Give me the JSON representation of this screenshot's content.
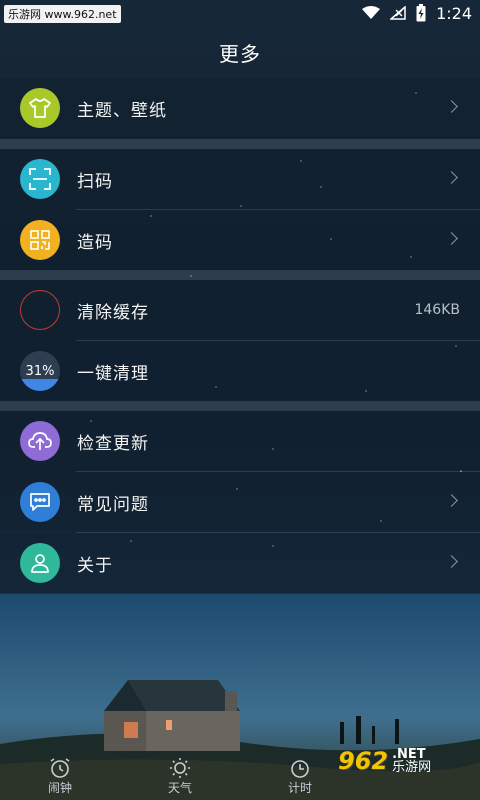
{
  "status_bar": {
    "watermark": "乐游网 www.962.net",
    "time": "1:24",
    "icons": [
      "wifi-icon",
      "signal-off-icon",
      "battery-charging-icon"
    ]
  },
  "header": {
    "title": "更多"
  },
  "menu": {
    "theme": {
      "label": "主题、壁纸",
      "icon": "tshirt-icon",
      "icon_color": "#a9c92b"
    },
    "scan": {
      "label": "扫码",
      "icon": "scan-icon",
      "icon_color": "#2bb6d0"
    },
    "make_code": {
      "label": "造码",
      "icon": "qr-code-icon",
      "icon_color": "#f2b21f"
    },
    "clear_cache": {
      "label": "清除缓存",
      "value": "146KB",
      "icon": "ring-icon",
      "icon_color": "#c23a3a"
    },
    "clean": {
      "label": "一键清理",
      "value": "31%",
      "fill_fraction": 0.31,
      "icon_color": "#3f86e6"
    },
    "update": {
      "label": "检查更新",
      "icon": "cloud-upload-icon",
      "icon_color": "#8f6bd6"
    },
    "faq": {
      "label": "常见问题",
      "icon": "chat-bubble-icon",
      "icon_color": "#2f7fd9"
    },
    "about": {
      "label": "关于",
      "icon": "user-icon",
      "icon_color": "#2fb89a"
    }
  },
  "bottom_nav": {
    "tabs": [
      {
        "label": "闹钟",
        "icon": "alarm-clock-icon"
      },
      {
        "label": "天气",
        "icon": "sun-icon"
      },
      {
        "label": "计时",
        "icon": "timer-icon"
      }
    ]
  },
  "watermark_br": {
    "num": "962",
    "text": "乐游网",
    "net": ".NET"
  }
}
